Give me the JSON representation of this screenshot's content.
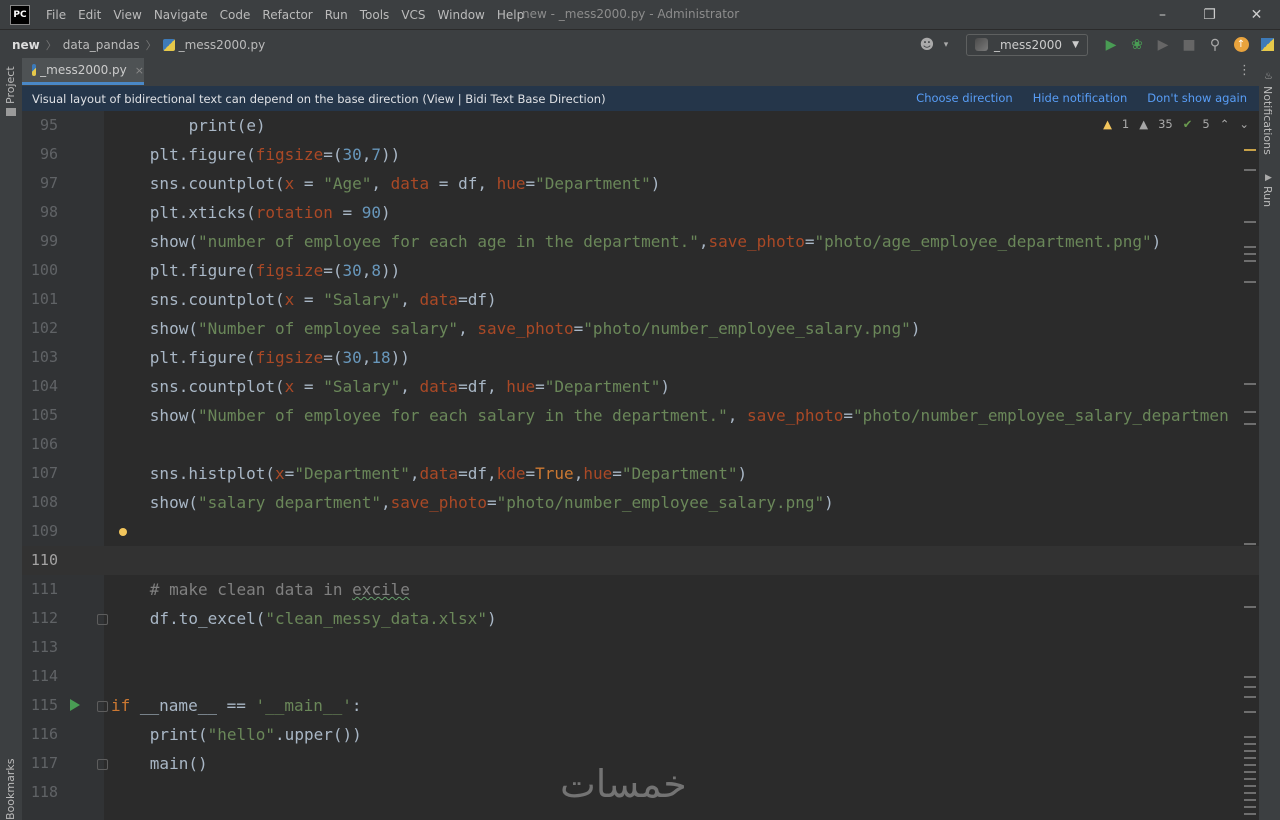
{
  "menubar": {
    "logo": "PC",
    "items": [
      "File",
      "Edit",
      "View",
      "Navigate",
      "Code",
      "Refactor",
      "Run",
      "Tools",
      "VCS",
      "Window",
      "Help"
    ],
    "title": "new - _mess2000.py - Administrator"
  },
  "navbar": {
    "crumbs": [
      "new",
      "data_pandas",
      "_mess2000.py"
    ],
    "run_config": "_mess2000"
  },
  "tabs": [
    {
      "label": "_mess2000.py",
      "close": "×"
    }
  ],
  "left_strip": {
    "project": "Project",
    "bookmarks": "Bookmarks"
  },
  "right_strip": {
    "notifications": "Notifications",
    "run": "Run"
  },
  "notification": {
    "message": "Visual layout of bidirectional text can depend on the base direction (View | Bidi Text Base Direction)",
    "actions": [
      "Choose direction",
      "Hide notification",
      "Don't show again"
    ]
  },
  "inspection": {
    "warnings": "1",
    "weak_warnings": "35",
    "typos": "5"
  },
  "watermark": "خمسات",
  "code_lines": [
    {
      "n": "95",
      "indent": 8,
      "html": "<span>print</span>(e)"
    },
    {
      "n": "96",
      "indent": 4,
      "html": "plt.figure(<span class=\"param\">figsize</span>=(<span class=\"num\">30</span>,<span class=\"num\">7</span>))"
    },
    {
      "n": "97",
      "indent": 4,
      "html": "sns.countplot(<span class=\"param\">x</span> = <span class=\"str\">\"Age\"</span>, <span class=\"param\">data</span> = df, <span class=\"param\">hue</span>=<span class=\"str\">\"Department\"</span>)"
    },
    {
      "n": "98",
      "indent": 4,
      "html": "plt.xticks(<span class=\"param\">rotation</span> = <span class=\"num\">90</span>)"
    },
    {
      "n": "99",
      "indent": 4,
      "html": "show(<span class=\"str\">\"number of employee for each age in the department.\"</span>,<span class=\"param\">save_photo</span>=<span class=\"str\">\"photo/age_employee_department.png\"</span>)"
    },
    {
      "n": "100",
      "indent": 4,
      "html": "plt.figure(<span class=\"param\">figsize</span>=(<span class=\"num\">30</span>,<span class=\"num\">8</span>))"
    },
    {
      "n": "101",
      "indent": 4,
      "html": "sns.countplot(<span class=\"param\">x</span> = <span class=\"str\">\"Salary\"</span>, <span class=\"param\">data</span>=df)"
    },
    {
      "n": "102",
      "indent": 4,
      "html": "show(<span class=\"str\">\"Number of employee salary\"</span>, <span class=\"param\">save_photo</span>=<span class=\"str\">\"photo/number_employee_salary.png\"</span>)"
    },
    {
      "n": "103",
      "indent": 4,
      "html": "plt.figure(<span class=\"param\">figsize</span>=(<span class=\"num\">30</span>,<span class=\"num\">18</span>))"
    },
    {
      "n": "104",
      "indent": 4,
      "html": "sns.countplot(<span class=\"param\">x</span> = <span class=\"str\">\"Salary\"</span>, <span class=\"param\">data</span>=df, <span class=\"param\">hue</span>=<span class=\"str\">\"Department\"</span>)"
    },
    {
      "n": "105",
      "indent": 4,
      "html": "show(<span class=\"str\">\"Number of employee for each salary in the department.\"</span>, <span class=\"param\">save_photo</span>=<span class=\"str\">\"photo/number_employee_salary_departmen</span>"
    },
    {
      "n": "106",
      "indent": 0,
      "html": ""
    },
    {
      "n": "107",
      "indent": 4,
      "html": "sns.histplot(<span class=\"param\">x</span>=<span class=\"str\">\"Department\"</span>,<span class=\"param\">data</span>=df,<span class=\"param\">kde</span>=<span class=\"kw\">True</span>,<span class=\"param\">hue</span>=<span class=\"str\">\"Department\"</span>)"
    },
    {
      "n": "108",
      "indent": 4,
      "html": "show(<span class=\"str\">\"salary department\"</span>,<span class=\"param\">save_photo</span>=<span class=\"str\">\"photo/number_employee_salary.png\"</span>)"
    },
    {
      "n": "109",
      "indent": 0,
      "html": ""
    },
    {
      "n": "110",
      "indent": 0,
      "html": "",
      "current": true
    },
    {
      "n": "111",
      "indent": 4,
      "html": "<span class=\"cmt\"># make clean data in <span class=\"uline\">excile</span></span>"
    },
    {
      "n": "112",
      "indent": 4,
      "html": "df.to_excel(<span class=\"str\">\"clean_messy_data.xlsx\"</span>)"
    },
    {
      "n": "113",
      "indent": 0,
      "html": ""
    },
    {
      "n": "114",
      "indent": 0,
      "html": ""
    },
    {
      "n": "115",
      "indent": 0,
      "html": "<span class=\"kw\">if</span> __name__ == <span class=\"str\">'__main__'</span>:"
    },
    {
      "n": "116",
      "indent": 4,
      "html": "<span>print</span>(<span class=\"str\">\"hello\"</span>.upper())"
    },
    {
      "n": "117",
      "indent": 4,
      "html": "main()"
    },
    {
      "n": "118",
      "indent": 0,
      "html": ""
    }
  ]
}
